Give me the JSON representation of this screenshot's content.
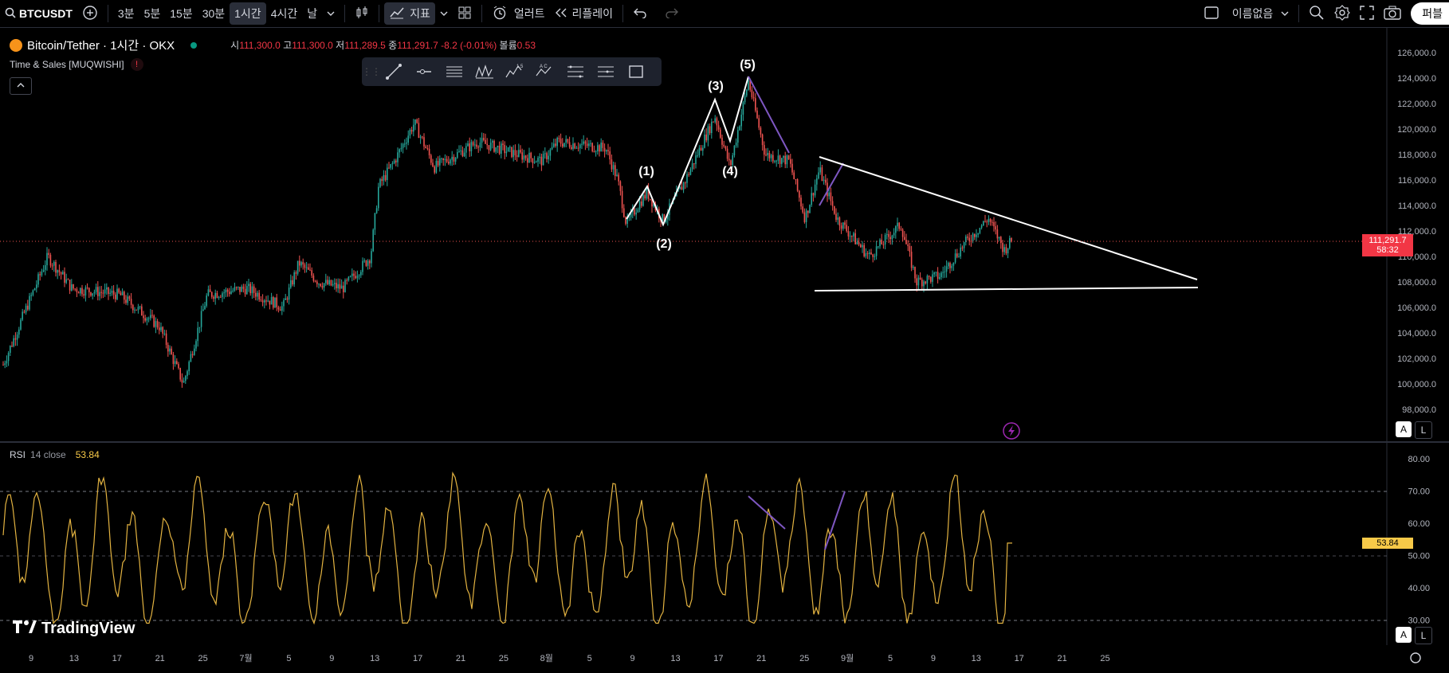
{
  "topbar": {
    "symbol": "BTCUSDT",
    "intervals": [
      "3분",
      "5분",
      "15분",
      "30분",
      "1시간",
      "4시간",
      "날"
    ],
    "active_interval": "1시간",
    "indicators_label": "지표",
    "alert_label": "얼러트",
    "replay_label": "리플레이",
    "layout_name": "이름없음",
    "publish_label": "퍼블"
  },
  "legend": {
    "title": "Bitcoin/Tether · 1시간 · OKX",
    "open_label": "시",
    "open": "111,300.0",
    "high_label": "고",
    "high": "111,300.0",
    "low_label": "저",
    "low": "111,289.5",
    "close_label": "종",
    "close": "111,291.7",
    "change": "-8.2 (-0.01%)",
    "volume_label": "볼륨",
    "volume": "0.53"
  },
  "indicator": {
    "name": "Time & Sales [MUQWISHI]",
    "error_mark": "!"
  },
  "price_axis": {
    "labels": [
      "126,000.0",
      "124,000.0",
      "122,000.0",
      "120,000.0",
      "118,000.0",
      "116,000.0",
      "114,000.0",
      "112,000.0",
      "110,000.0",
      "108,000.0",
      "106,000.0",
      "104,000.0",
      "102,000.0",
      "100,000.0",
      "98,000.0"
    ],
    "current_price": "111,291.7",
    "countdown": "58:32"
  },
  "rsi": {
    "label": "RSI",
    "params": "14 close",
    "value": "53.84",
    "axis_labels": [
      "80.00",
      "70.00",
      "60.00",
      "50.00",
      "40.00",
      "30.00"
    ]
  },
  "time_axis": [
    "9",
    "13",
    "17",
    "21",
    "25",
    "7월",
    "5",
    "9",
    "13",
    "17",
    "21",
    "25",
    "8월",
    "5",
    "9",
    "13",
    "17",
    "21",
    "25",
    "9월",
    "5",
    "9",
    "13",
    "17",
    "21",
    "25"
  ],
  "waves": [
    "(1)",
    "(2)",
    "(3)",
    "(4)",
    "(5)"
  ],
  "scale_buttons": {
    "auto": "A",
    "log": "L"
  },
  "brand": "TradingView",
  "colors": {
    "up": "#26a69a",
    "down": "#ef5350",
    "rsi": "#e3b341",
    "accent": "#f23645",
    "divergence": "#7e57c2"
  }
}
